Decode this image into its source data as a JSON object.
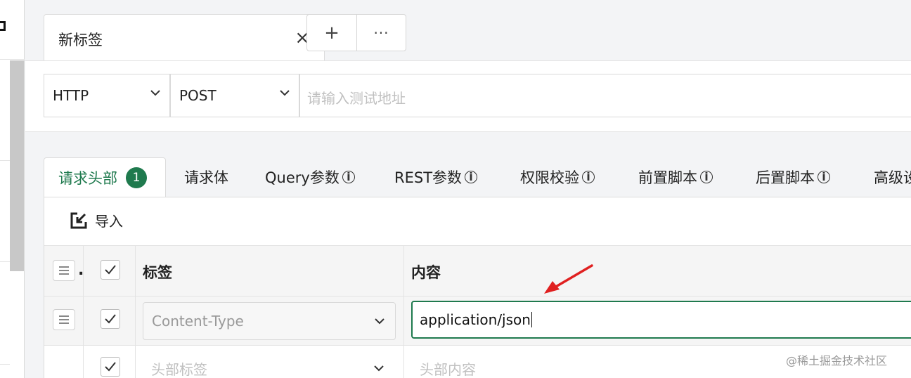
{
  "tabs": {
    "active_label": "新标签",
    "close_icon": "×",
    "add_label": "+",
    "more_label": "···"
  },
  "url_bar": {
    "protocol": "HTTP",
    "method": "POST",
    "url_placeholder": "请输入测试地址"
  },
  "request_tabs": {
    "headers": "请求头部",
    "headers_count": "1",
    "body": "请求体",
    "query": "Query参数",
    "rest": "REST参数",
    "auth": "权限校验",
    "pre_script": "前置脚本",
    "post_script": "后置脚本",
    "advanced": "高级设"
  },
  "headers_panel": {
    "import_label": "导入",
    "columns": {
      "label": "标签",
      "value": "内容"
    },
    "rows": [
      {
        "label": "Content-Type",
        "value": "application/json",
        "checked": true
      }
    ],
    "new_row": {
      "label_placeholder": "头部标签",
      "value_placeholder": "头部内容"
    }
  },
  "colors": {
    "accent": "#1f7a4e",
    "arrow": "#e02020"
  },
  "watermark": "@稀土掘金技术社区"
}
